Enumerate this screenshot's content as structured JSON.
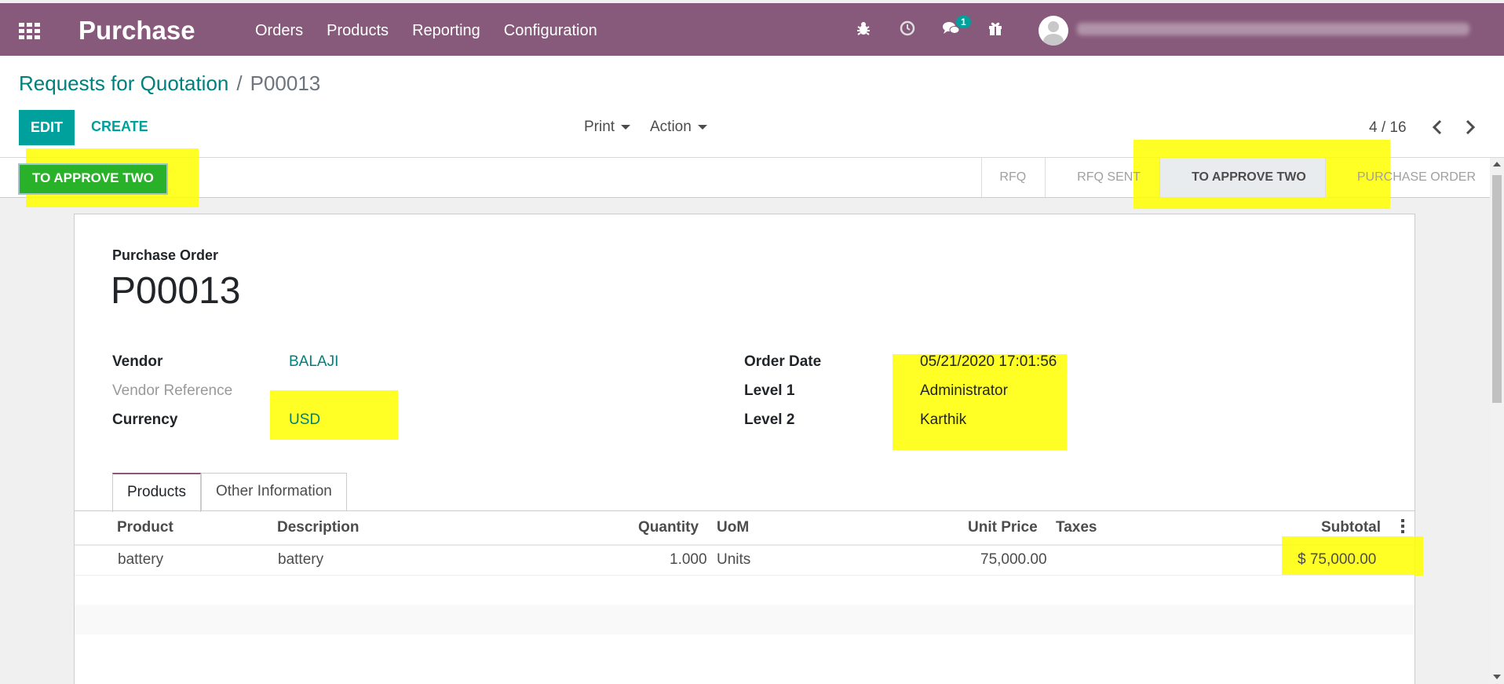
{
  "navbar": {
    "app_name": "Purchase",
    "menu": [
      "Orders",
      "Products",
      "Reporting",
      "Configuration"
    ],
    "chat_badge": "1",
    "icons": [
      "apps-icon",
      "bug-icon",
      "clock-icon",
      "chat-icon",
      "gift-icon",
      "avatar"
    ]
  },
  "breadcrumb": {
    "parent": "Requests for Quotation",
    "separator": "/",
    "current": "P00013"
  },
  "controls": {
    "edit": "EDIT",
    "create": "CREATE",
    "print": "Print",
    "action": "Action",
    "pager": "4 / 16"
  },
  "status": {
    "approve_button": "TO APPROVE TWO",
    "stages": [
      "RFQ",
      "RFQ SENT",
      "TO APPROVE TWO",
      "PURCHASE ORDER"
    ],
    "active_stage": "TO APPROVE TWO"
  },
  "form": {
    "doc_label": "Purchase Order",
    "doc_name": "P00013",
    "vendor_label": "Vendor",
    "vendor": "BALAJI",
    "vendor_ref_label": "Vendor Reference",
    "currency_label": "Currency",
    "currency": "USD",
    "order_date_label": "Order Date",
    "order_date": "05/21/2020 17:01:56",
    "level1_label": "Level 1",
    "level1": "Administrator",
    "level2_label": "Level 2",
    "level2": "Karthik"
  },
  "tabs": [
    "Products",
    "Other Information"
  ],
  "table": {
    "headers": [
      "Product",
      "Description",
      "Quantity",
      "UoM",
      "Unit Price",
      "Taxes",
      "Subtotal"
    ],
    "rows": [
      {
        "product": "battery",
        "description": "battery",
        "quantity": "1.000",
        "uom": "Units",
        "unit_price": "75,000.00",
        "taxes": "",
        "subtotal": "$ 75,000.00"
      }
    ]
  },
  "colors": {
    "navbar": "#875a7b",
    "primary": "#00a09d",
    "highlight": "#ffff00",
    "approve_button": "#2ab12a"
  }
}
